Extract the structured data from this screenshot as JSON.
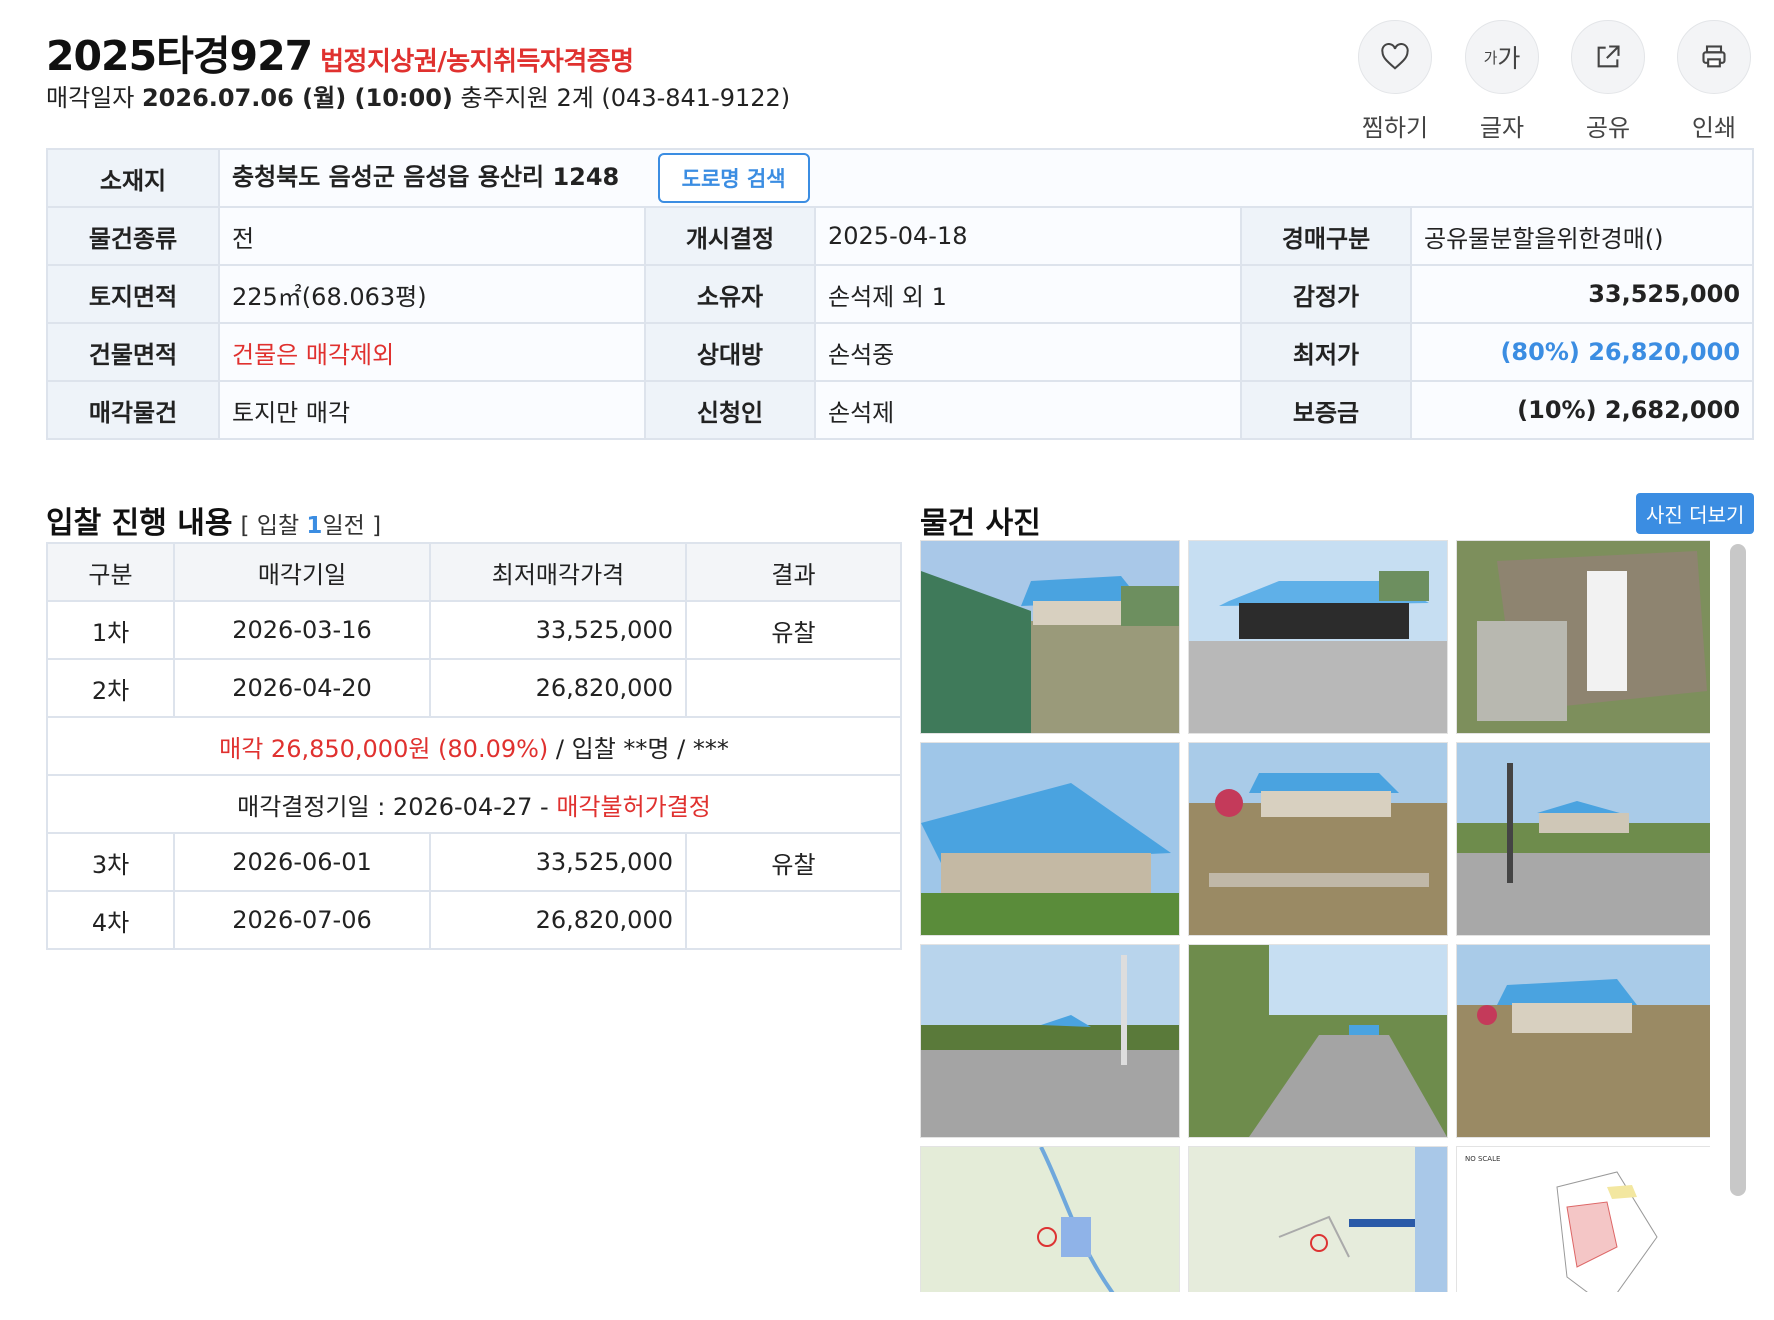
{
  "header": {
    "case_no": "2025타경927",
    "case_tag": "법정지상권/농지취득자격증명",
    "sale_label": "매각일자",
    "sale_datetime": "2026.07.06 (월) (10:00)",
    "court": "충주지원 2계 (043-841-9122)"
  },
  "actions": [
    {
      "label": "찜하기",
      "icon": "heart-icon"
    },
    {
      "label": "글자",
      "icon": "font-size-icon",
      "glyph_small": "가",
      "glyph_big": "가"
    },
    {
      "label": "공유",
      "icon": "share-icon"
    },
    {
      "label": "인쇄",
      "icon": "print-icon"
    }
  ],
  "info": {
    "location_label": "소재지",
    "location": "충청북도 음성군 음성읍 용산리 1248",
    "road_search": "도로명 검색",
    "rows": [
      [
        "물건종류",
        "전",
        "개시결정",
        "2025-04-18",
        "경매구분",
        "공유물분할을위한경매()"
      ],
      [
        "토지면적",
        "225㎡(68.063평)",
        "소유자",
        "손석제 외 1",
        "감정가",
        "33,525,000"
      ],
      [
        "건물면적",
        "건물은 매각제외",
        "상대방",
        "손석중",
        "최저가",
        "(80%) 26,820,000"
      ],
      [
        "매각물건",
        "토지만 매각",
        "신청인",
        "손석제",
        "보증금",
        "(10%) 2,682,000"
      ]
    ]
  },
  "bid": {
    "title": "입찰 진행 내용",
    "sub_prefix": "[ 입찰 ",
    "sub_num": "1",
    "sub_suffix": "일전 ]",
    "columns": [
      "구분",
      "매각기일",
      "최저매각가격",
      "결과"
    ],
    "rows_a": [
      [
        "1차",
        "2026-03-16",
        "33,525,000",
        "유찰"
      ],
      [
        "2차",
        "2026-04-20",
        "26,820,000",
        ""
      ]
    ],
    "sold_line_red": "매각 26,850,000원 (80.09%)",
    "sold_line_rest": " / 입찰 **명 / ***",
    "decision_prefix": "매각결정기일 : 2026-04-27 - ",
    "decision_red": "매각불허가결정",
    "rows_b": [
      [
        "3차",
        "2026-06-01",
        "33,525,000",
        "유찰"
      ],
      [
        "4차",
        "2026-07-06",
        "26,820,000",
        ""
      ]
    ]
  },
  "photos": {
    "title": "물건 사진",
    "more": "사진 더보기",
    "map_label": "NO SCALE"
  },
  "colors": {
    "accent": "#3b8de2",
    "alert": "#e0312f",
    "border": "#dde3ec",
    "label_bg": "#eef3f9"
  }
}
